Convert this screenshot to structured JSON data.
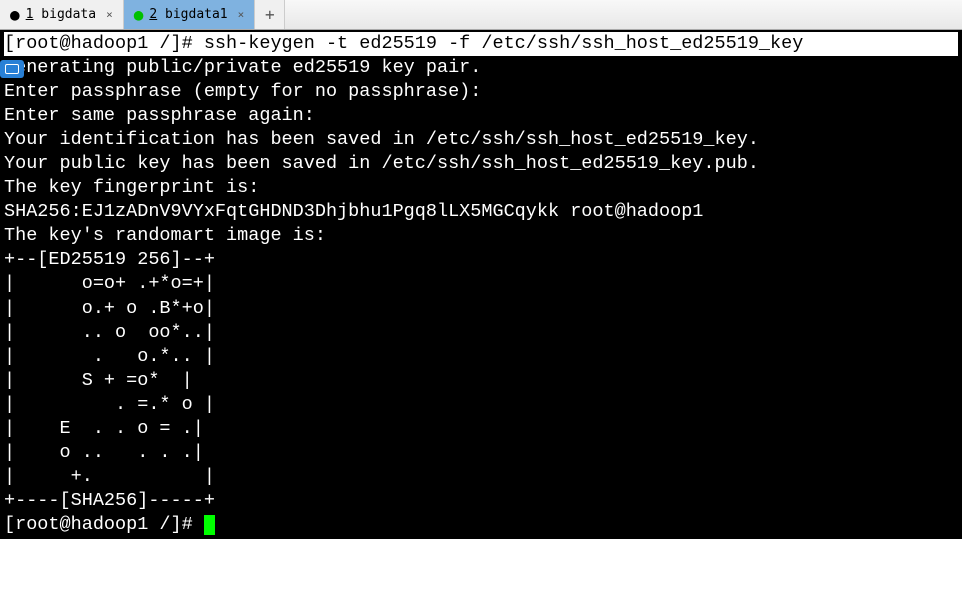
{
  "tabs": {
    "items": [
      {
        "index": "1",
        "label": "bigdata",
        "active": false,
        "dotClass": "black"
      },
      {
        "index": "2",
        "label": "bigdata1",
        "active": true,
        "dotClass": "green"
      }
    ],
    "new_label": "+"
  },
  "terminal": {
    "highlighted_prompt": "[root@hadoop1 /]# ssh-keygen -t ed25519 -f /etc/ssh/ssh_host_ed25519_key",
    "lines": [
      "Generating public/private ed25519 key pair.",
      "Enter passphrase (empty for no passphrase):",
      "Enter same passphrase again:",
      "Your identification has been saved in /etc/ssh/ssh_host_ed25519_key.",
      "Your public key has been saved in /etc/ssh/ssh_host_ed25519_key.pub.",
      "The key fingerprint is:",
      "SHA256:EJ1zADnV9VYxFqtGHDND3Dhjbhu1Pgq8lLX5MGCqykk root@hadoop1",
      "The key's randomart image is:",
      "+--[ED25519 256]--+",
      "|      o=o+ .+*o=+|",
      "|      o.+ o .B*+o|",
      "|      .. o  oo*..|",
      "|       .   o.*.. |",
      "|      S + =o*  |",
      "|         . =.* o |",
      "|    E  . . o = .|",
      "|    o ..   . . .|",
      "|     +.          |",
      "+----[SHA256]-----+"
    ],
    "final_prompt": "[root@hadoop1 /]# "
  }
}
